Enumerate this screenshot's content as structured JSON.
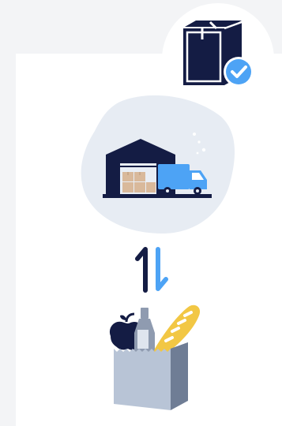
{
  "colors": {
    "background": "#f3f4f6",
    "card": "#ffffff",
    "navy": "#141c44",
    "accent_blue": "#4da3f5",
    "blob": "#e7ecf3",
    "boxes": "#d9b99b",
    "bag": "#b8c4d6",
    "bread": "#f2c744"
  },
  "icons": {
    "package": "package-delivered-icon",
    "check": "check-badge-icon",
    "warehouse": "warehouse-truck-icon",
    "exchange": "exchange-arrows-icon",
    "groceries": "grocery-bag-icon"
  }
}
